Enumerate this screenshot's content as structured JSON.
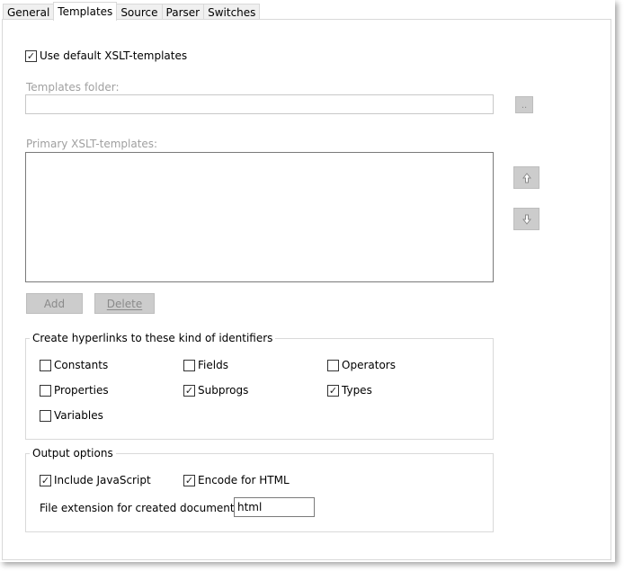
{
  "tabs": [
    {
      "label": "General"
    },
    {
      "label": "Templates"
    },
    {
      "label": "Source"
    },
    {
      "label": "Parser"
    },
    {
      "label": "Switches"
    }
  ],
  "use_default": {
    "label": "Use default XSLT-templates",
    "checked": true
  },
  "templates_folder": {
    "label": "Templates folder:",
    "value": ""
  },
  "browse_label": "..",
  "primary": {
    "label": "Primary XSLT-templates:"
  },
  "buttons": {
    "add": "Add",
    "delete": "Delete"
  },
  "hyperlinks": {
    "title": "Create hyperlinks to these kind of identifiers",
    "items": [
      {
        "label": "Constants",
        "checked": false
      },
      {
        "label": "Fields",
        "checked": false
      },
      {
        "label": "Operators",
        "checked": false
      },
      {
        "label": "Properties",
        "checked": false
      },
      {
        "label": "Subprogs",
        "checked": true
      },
      {
        "label": "Types",
        "checked": true
      },
      {
        "label": "Variables",
        "checked": false
      }
    ]
  },
  "output": {
    "title": "Output options",
    "include_js": {
      "label": "Include JavaScript",
      "checked": true
    },
    "encode_html": {
      "label": "Encode for HTML",
      "checked": true
    },
    "ext_label": "File extension for created documents:",
    "ext_value": "html"
  },
  "icons": {
    "move_up": "arrow-up-icon",
    "move_down": "arrow-down-icon",
    "check": "check-icon"
  }
}
